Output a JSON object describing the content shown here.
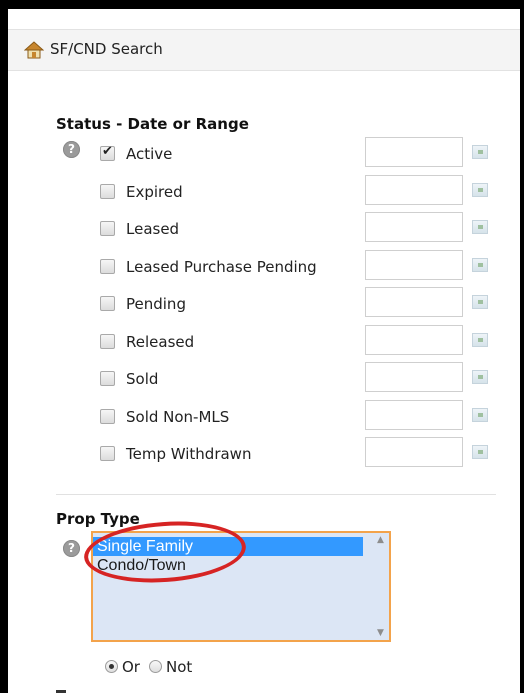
{
  "header": {
    "title": "SF/CND Search",
    "icon": "home-icon"
  },
  "status_section": {
    "title": "Status - Date or Range",
    "items": [
      {
        "label": "Active",
        "checked": true,
        "date_value": ""
      },
      {
        "label": "Expired",
        "checked": false,
        "date_value": ""
      },
      {
        "label": "Leased",
        "checked": false,
        "date_value": ""
      },
      {
        "label": "Leased Purchase Pending",
        "checked": false,
        "date_value": ""
      },
      {
        "label": "Pending",
        "checked": false,
        "date_value": ""
      },
      {
        "label": "Released",
        "checked": false,
        "date_value": ""
      },
      {
        "label": "Sold",
        "checked": false,
        "date_value": ""
      },
      {
        "label": "Sold Non-MLS",
        "checked": false,
        "date_value": ""
      },
      {
        "label": "Temp Withdrawn",
        "checked": false,
        "date_value": ""
      }
    ]
  },
  "prop_type_section": {
    "title": "Prop Type",
    "options": [
      {
        "label": "Single Family",
        "selected": true
      },
      {
        "label": "Condo/Town",
        "selected": false
      }
    ],
    "mode": {
      "or_label": "Or",
      "not_label": "Not",
      "selected": "Or"
    }
  },
  "colors": {
    "selection": "#3399ff",
    "listbox_border": "#f3a34b",
    "annotation": "#d62424"
  }
}
